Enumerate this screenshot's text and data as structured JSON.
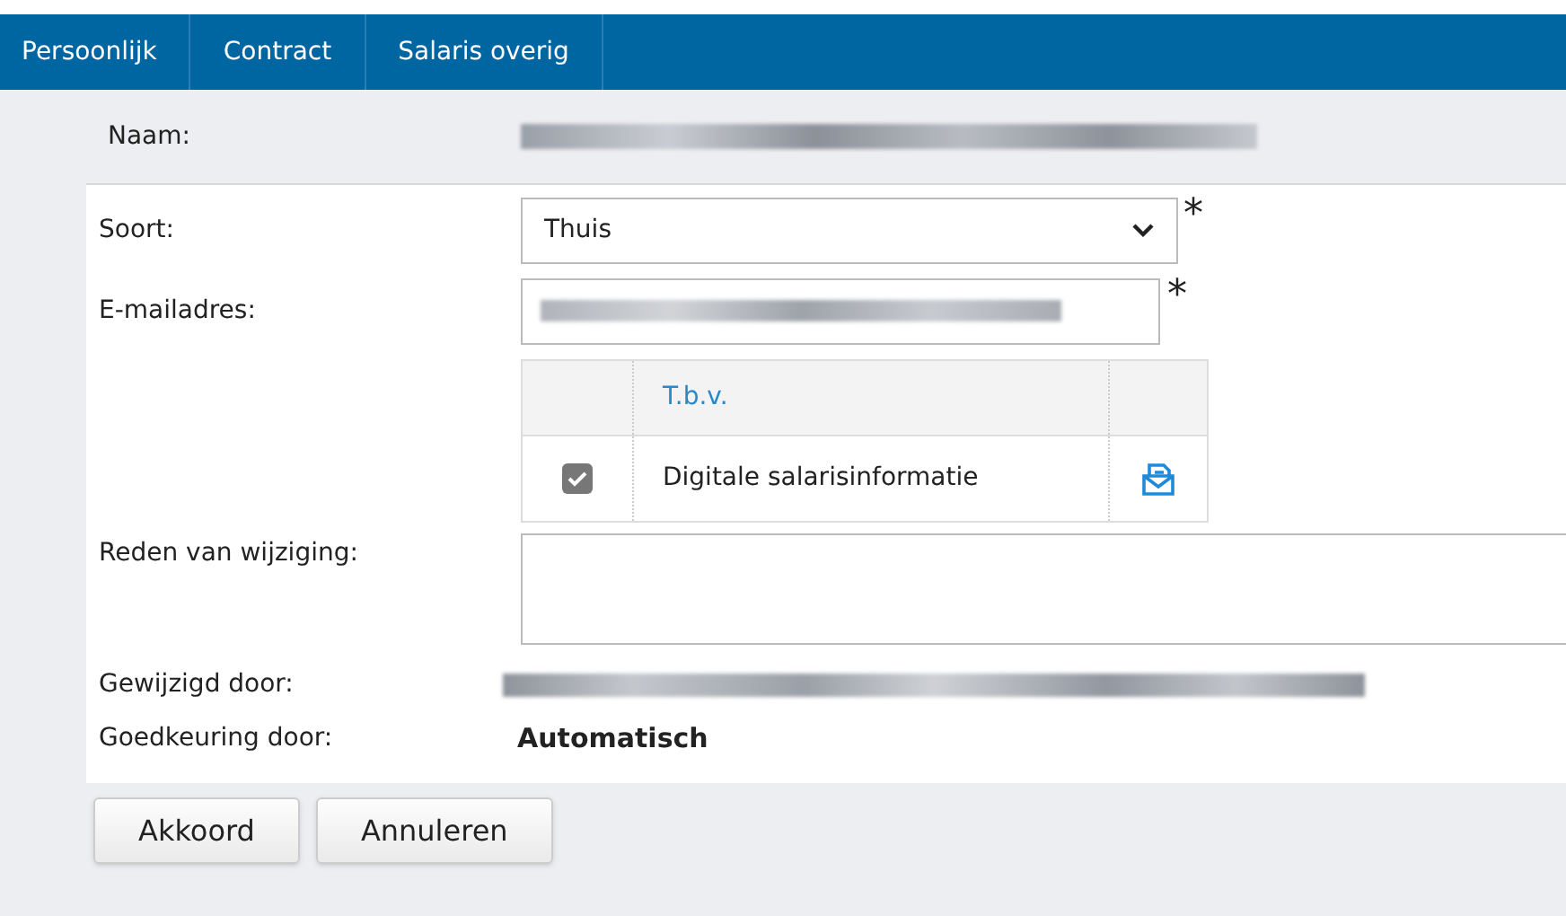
{
  "tabs": [
    {
      "label": "Persoonlijk",
      "selected": false
    },
    {
      "label": "Contract",
      "selected": false
    },
    {
      "label": "Salaris overig",
      "selected": false
    }
  ],
  "name_row": {
    "label": "Naam:"
  },
  "form": {
    "soort": {
      "label": "Soort:",
      "value": "Thuis",
      "required_mark": "*"
    },
    "email": {
      "label": "E-mailadres:",
      "required_mark": "*"
    },
    "tbv_table": {
      "columns": [
        "T.b.v."
      ],
      "rows": [
        {
          "checked": true,
          "text": "Digitale salarisinformatie"
        }
      ]
    },
    "reden": {
      "label": "Reden van wijziging:"
    },
    "gewijzigd": {
      "label": "Gewijzigd door:"
    },
    "goedkeuring": {
      "label": "Goedkeuring door:",
      "value": "Automatisch"
    }
  },
  "buttons": [
    "Akkoord",
    "Annuleren"
  ]
}
